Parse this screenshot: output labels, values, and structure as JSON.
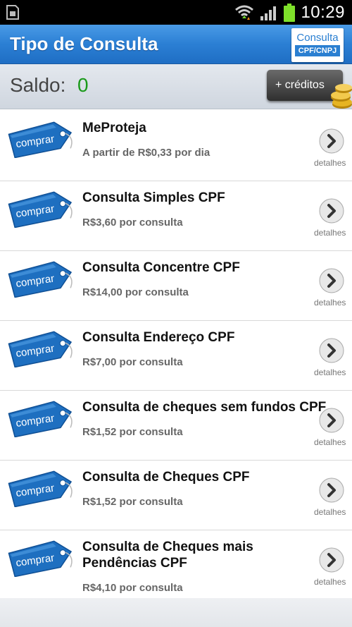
{
  "status_bar": {
    "time": "10:29",
    "icons": [
      "sim-icon",
      "wifi-icon",
      "signal-icon",
      "battery-icon"
    ],
    "battery_color": "#7ee02a"
  },
  "header": {
    "title": "Tipo de Consulta",
    "cpf_button": {
      "top": "Consulta",
      "bottom": "CPF/CNPJ"
    }
  },
  "balance": {
    "label": "Saldo:",
    "value": "0",
    "value_color": "#1b9a1b",
    "buy_credits_label": "+ créditos"
  },
  "products": {
    "tag_label": "comprar",
    "details_label": "detalhes",
    "items": [
      {
        "name": "MeProteja",
        "price": "A partir de R$0,33 por dia"
      },
      {
        "name": "Consulta Simples CPF",
        "price": "R$3,60 por consulta"
      },
      {
        "name": "Consulta Concentre CPF",
        "price": "R$14,00 por consulta"
      },
      {
        "name": "Consulta Endereço CPF",
        "price": "R$7,00 por consulta"
      },
      {
        "name": "Consulta de cheques sem fundos CPF",
        "price": "R$1,52 por consulta"
      },
      {
        "name": "Consulta de Cheques CPF",
        "price": "R$1,52 por consulta"
      },
      {
        "name": "Consulta de Cheques mais Pendências CPF",
        "price": "R$4,10 por consulta"
      }
    ]
  },
  "colors": {
    "title_bar": "#2b7fd4",
    "tag_blue": "#1e6fc0"
  }
}
